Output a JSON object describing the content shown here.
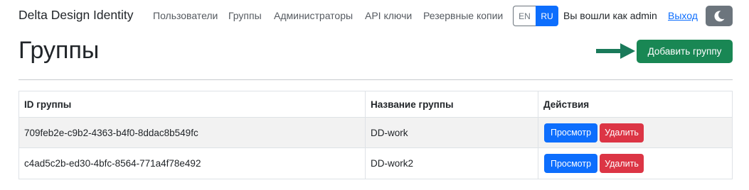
{
  "navbar": {
    "brand": "Delta Design Identity",
    "links": [
      {
        "label": "Пользователи"
      },
      {
        "label": "Группы"
      },
      {
        "label": "Администраторы"
      },
      {
        "label": "API ключи"
      },
      {
        "label": "Резервные копии"
      }
    ],
    "lang": {
      "en": "EN",
      "ru": "RU",
      "active": "RU"
    },
    "login_status": "Вы вошли как admin",
    "logout": "Выход",
    "theme_icon": "moon-icon"
  },
  "page": {
    "title": "Группы",
    "add_button": "Добавить группу",
    "arrow_icon": "arrow-right-icon"
  },
  "table": {
    "headers": {
      "id": "ID группы",
      "name": "Название группы",
      "actions": "Действия"
    },
    "rows": [
      {
        "id": "709feb2e-c9b2-4363-b4f0-8ddac8b549fc",
        "name": "DD-work",
        "view": "Просмотр",
        "delete": "Удалить"
      },
      {
        "id": "c4ad5c2b-ed30-4bfc-8564-771a4f78e492",
        "name": "DD-work2",
        "view": "Просмотр",
        "delete": "Удалить"
      }
    ]
  },
  "colors": {
    "primary": "#0d6efd",
    "success": "#198754",
    "danger": "#dc3545",
    "secondary": "#6c757d"
  }
}
